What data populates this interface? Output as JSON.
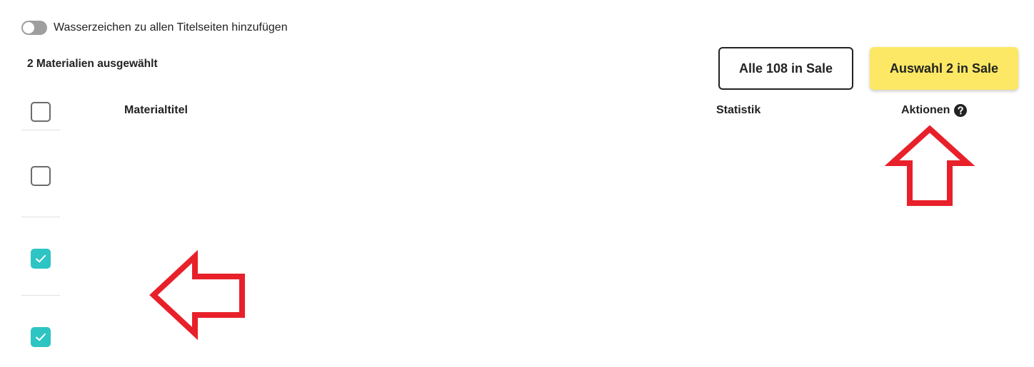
{
  "watermark_toggle": {
    "label": "Wasserzeichen zu allen Titelseiten hinzufügen",
    "enabled": false
  },
  "selection": {
    "count_label": "2 Materialien ausgewählt"
  },
  "buttons": {
    "sale_all_label": "Alle 108 in Sale",
    "sale_selection_label": "Auswahl 2 in Sale"
  },
  "table": {
    "columns": {
      "title": "Materialtitel",
      "statistics": "Statistik",
      "actions": "Aktionen"
    },
    "rows": [
      {
        "checked": false
      },
      {
        "checked": true
      },
      {
        "checked": true
      }
    ]
  },
  "colors": {
    "accent_teal": "#2ec4c4",
    "primary_yellow": "#fce864",
    "annotation_red": "#e8202a",
    "toggle_off": "#9e9e9e"
  },
  "icons": {
    "help": "question-circle-icon",
    "check": "check-icon"
  }
}
